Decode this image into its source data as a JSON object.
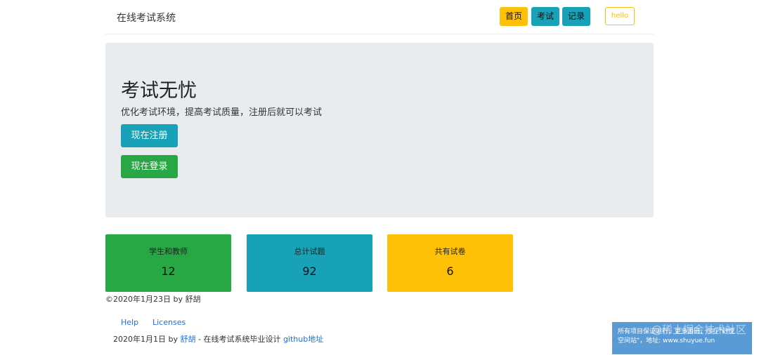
{
  "navbar": {
    "brand": "在线考试系统",
    "home_label": "首页",
    "exam_label": "考试",
    "records_label": "记录",
    "user_label": "hello"
  },
  "hero": {
    "title": "考试无忧",
    "description": "优化考试环境，提高考试质量，注册后就可以考试",
    "register_label": "现在注册",
    "login_label": "现在登录"
  },
  "stats": [
    {
      "label": "学生和教师",
      "value": "12",
      "color": "#28a745"
    },
    {
      "label": "总计试题",
      "value": "92",
      "color": "#17a2b8"
    },
    {
      "label": "共有试卷",
      "value": "6",
      "color": "#ffc107"
    }
  ],
  "copyright": "©2020年1月23日 by 舒胡",
  "footer": {
    "help_label": "Help",
    "licenses_label": "Licenses",
    "credit_prefix": "2020年1月1日 by ",
    "author": "舒胡",
    "credit_middle": " - 在线考试系统毕业设计 ",
    "github_label": "github地址"
  },
  "watermark": {
    "line1": "所有项目保证运行，更多源码，尽在\"舒悦",
    "line2": "空间站\"，地址: www.shuyue.fun",
    "badge": "@稀土掘金技术社区"
  },
  "colors": {
    "warning": "#ffc107",
    "info": "#17a2b8",
    "success": "#28a745",
    "jumbotron_bg": "#e9ecef",
    "link": "#1e6fd9"
  }
}
